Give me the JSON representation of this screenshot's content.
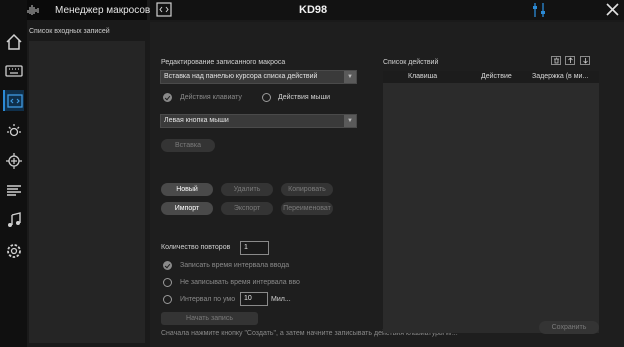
{
  "app": {
    "title": "Менеджер макросов",
    "device": "KD98"
  },
  "sidebar": {
    "records_label": "Список входных записей",
    "icons": [
      "home-icon",
      "keyboard-icon",
      "macro-icon",
      "lighting-icon",
      "network-icon",
      "list-icon",
      "music-icon",
      "settings-icon"
    ]
  },
  "editor": {
    "section_label": "Редактирование записанного макроса",
    "insert_mode": "Вставка над панелью курсора списка действий",
    "radio_keyboard": "Действия клавиату",
    "radio_mouse": "Действия мыши",
    "mouse_action": "Левая кнопка мыши",
    "insert_button": "Вставка"
  },
  "buttons": {
    "new": "Новый",
    "delete": "Удалить",
    "copy": "Копировать",
    "import": "Импорт",
    "export": "Экспорт",
    "rename": "Переименоват"
  },
  "repeat": {
    "label": "Количество повторов",
    "value": "1"
  },
  "interval": {
    "record_input": "Записать время интервала ввода",
    "no_record": "Не записывать время интервала вво",
    "default_label": "Интервал по умо",
    "default_value": "10",
    "unit": "Мил..."
  },
  "start_record": "Начать запись",
  "hint": "Сначала нажмите кнопку \"Создать\", а затем начните записывать действия клавиатуры и/...",
  "actions": {
    "label": "Список действий",
    "columns": [
      "Клавиша",
      "Действие",
      "Задержка (в ми..."
    ]
  },
  "save": "Сохранить",
  "colors": {
    "accent": "#2b8ad6",
    "panel": "#1e1e1e"
  }
}
